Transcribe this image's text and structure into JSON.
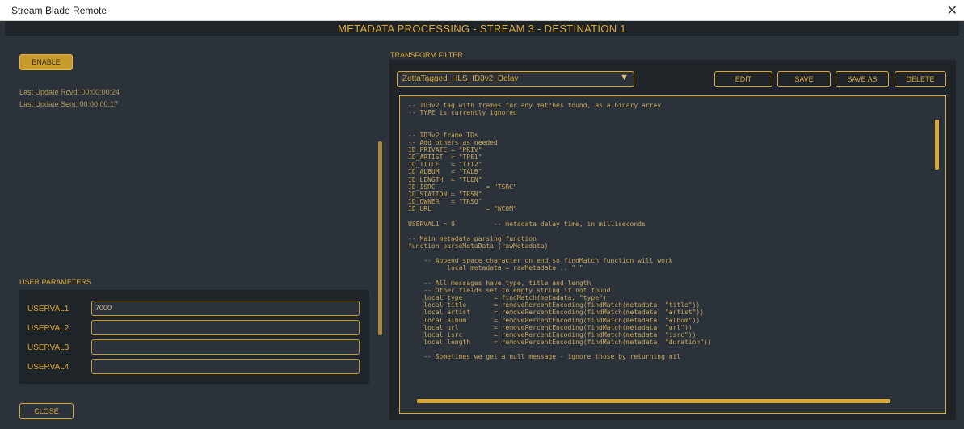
{
  "window": {
    "title": "Stream Blade Remote",
    "close_glyph": "✕"
  },
  "header": {
    "title": "METADATA PROCESSING - STREAM 3 - DESTINATION 1"
  },
  "left": {
    "enable_label": "ENABLE",
    "last_update_rcvd": "Last Update Rcvd: 00:00:00:24",
    "last_update_sent": "Last Update Sent: 00:00:00:17",
    "user_parameters_label": "USER PARAMETERS",
    "params": [
      {
        "label": "USERVAL1",
        "value": "7000"
      },
      {
        "label": "USERVAL2",
        "value": ""
      },
      {
        "label": "USERVAL3",
        "value": ""
      },
      {
        "label": "USERVAL4",
        "value": ""
      }
    ],
    "close_label": "CLOSE"
  },
  "transform": {
    "section_label": "TRANSFORM FILTER",
    "selected_filter": "ZettaTagged_HLS_ID3v2_Delay",
    "buttons": {
      "edit": "EDIT",
      "save": "SAVE",
      "save_as": "SAVE AS",
      "delete": "DELETE"
    },
    "code": "-- ID3v2 tag with frames for any matches found, as a binary array\n-- TYPE is currently ignored\n\n\n-- ID3v2 frame IDs\n-- Add others as needed\nID_PRIVATE = \"PRIV\"\nID_ARTIST  = \"TPE1\"\nID_TITLE   = \"TIT2\"\nID_ALBUM   = \"TALB\"\nID_LENGTH  = \"TLEN\"\nID_ISRC             = \"TSRC\"\nID_STATION = \"TRSN\"\nID_OWNER   = \"TRSO\"\nID_URL              = \"WCOM\"\n\nUSERVAL1 = 0          -- metadata delay time, in milliseconds\n\n-- Main metadata parsing function\nfunction parseMetaData (rawMetadata)\n\n    -- Append space character on end so findMatch function will work\n          local metadata = rawMetadata .. \" \"\n\n    -- All messages have type, title and length\n    -- Other fields set to empty string if not found\n    local type        = findMatch(metadata, \"type\")\n    local title       = removePercentEncoding(findMatch(metadata, \"title\"))\n    local artist      = removePercentEncoding(findMatch(metadata, \"artist\"))\n    local album       = removePercentEncoding(findMatch(metadata, \"album\"))\n    local url         = removePercentEncoding(findMatch(metadata, \"url\"))\n    local isrc        = removePercentEncoding(findMatch(metadata, \"isrc\"))\n    local length      = removePercentEncoding(findMatch(metadata, \"duration\"))\n\n    -- Sometimes we get a null message - ignore those by returning nil"
  },
  "colors": {
    "accent": "#d9a93a",
    "panel": "#1f2429",
    "background": "#2b3239"
  }
}
